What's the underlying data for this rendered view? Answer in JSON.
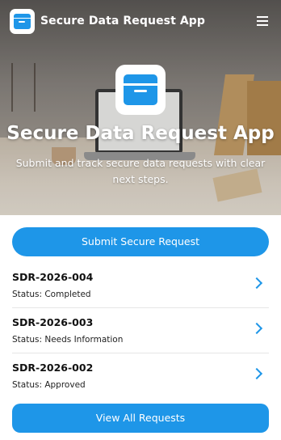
{
  "app": {
    "title": "Secure Data Request App",
    "brand_color": "#1e96e8"
  },
  "topbar": {
    "logo_icon": "archive-box-icon",
    "menu_icon": "hamburger-menu-icon"
  },
  "hero": {
    "logo_icon": "archive-box-icon",
    "title": "Secure Data Request App",
    "subtitle": "Submit and track secure data requests with clear next steps."
  },
  "actions": {
    "submit_label": "Submit Secure Request",
    "view_all_label": "View All Requests"
  },
  "requests": [
    {
      "id": "SDR-2026-004",
      "status": "Status: Completed",
      "icon": "chevron-right-icon"
    },
    {
      "id": "SDR-2026-003",
      "status": "Status: Needs Information",
      "icon": "chevron-right-icon"
    },
    {
      "id": "SDR-2026-002",
      "status": "Status: Approved",
      "icon": "chevron-right-icon"
    }
  ]
}
